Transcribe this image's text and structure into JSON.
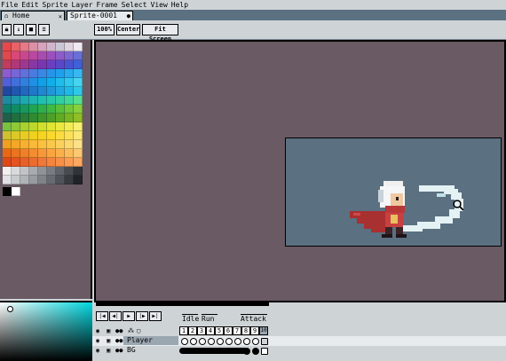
{
  "menu": [
    "File",
    "Edit",
    "Sprite",
    "Layer",
    "Frame",
    "Select",
    "View",
    "Help"
  ],
  "tabs": {
    "home": "Home",
    "sprite": "Sprite-0001",
    "close_glyph": "×",
    "add_glyph": "●"
  },
  "toolbar": {
    "zoom": "100%",
    "center": "Center",
    "fit": "Fit Screen"
  },
  "palette_icons": [
    "lock-icon",
    "sort-icon",
    "save-icon",
    "menu-icon"
  ],
  "palette_colors": [
    [
      "#e8484b",
      "#e86268",
      "#e47a88",
      "#dc90a6",
      "#d6a4bc",
      "#d0b6cc",
      "#cac6d6",
      "#e0d4e0",
      "#f0e8f0"
    ],
    [
      "#e04850",
      "#d84878",
      "#c84890",
      "#b848a0",
      "#a84cb0",
      "#9a50be",
      "#8c5cc8",
      "#7c68d0",
      "#6870d8"
    ],
    [
      "#c03c60",
      "#b03878",
      "#9c3890",
      "#8838a4",
      "#7838b0",
      "#6a40c0",
      "#5a48c8",
      "#4a54d0",
      "#4060d8"
    ],
    [
      "#8c5cd0",
      "#7866d8",
      "#6070dc",
      "#4a7ce0",
      "#3888e4",
      "#2894e8",
      "#20a0ec",
      "#28acee",
      "#38b8f0"
    ],
    [
      "#5060d8",
      "#4070dc",
      "#3080e0",
      "#2090e4",
      "#10a0e8",
      "#10aeea",
      "#20bcec",
      "#30c8ec",
      "#48d4ee"
    ],
    [
      "#2048a0",
      "#2058b0",
      "#2068c0",
      "#2078c8",
      "#2088d0",
      "#2098d8",
      "#20a8e0",
      "#20b8e4",
      "#30c8e8"
    ],
    [
      "#1e8aa0",
      "#1e98a8",
      "#1ea8b0",
      "#1eb4b0",
      "#20c0b0",
      "#28c8a8",
      "#30d0a0",
      "#40d898",
      "#58e090"
    ],
    [
      "#10806c",
      "#108c64",
      "#18985c",
      "#20a454",
      "#30ae4c",
      "#40b844",
      "#58c03c",
      "#70c83c",
      "#88d03c"
    ],
    [
      "#206048",
      "#206e40",
      "#287c38",
      "#308a30",
      "#3c962c",
      "#4ca028",
      "#60aa24",
      "#78b424",
      "#90be24"
    ],
    [
      "#7cc040",
      "#90c838",
      "#a8d030",
      "#bcd82c",
      "#d0e02c",
      "#e0e434",
      "#ece840",
      "#f4ec54",
      "#f8f070"
    ],
    [
      "#d0c030",
      "#dcc828",
      "#e8cc24",
      "#f0d020",
      "#f8d420",
      "#fcd82c",
      "#fcdc40",
      "#fce058",
      "#fce874"
    ],
    [
      "#f0a020",
      "#f4a828",
      "#f8b030",
      "#fcb838",
      "#fcc040",
      "#fcc84c",
      "#fcd05c",
      "#fcd870",
      "#fce088"
    ],
    [
      "#e86818",
      "#ec7420",
      "#f08028",
      "#f48c30",
      "#f89838",
      "#fca440",
      "#fcb04c",
      "#fcbc5c",
      "#fcc870"
    ],
    [
      "#e04818",
      "#e45420",
      "#e86028",
      "#ec6c30",
      "#f07838",
      "#f48440",
      "#f89048",
      "#fc9c54",
      "#fca860"
    ],
    [
      "#f0f0f0",
      "#d8dadc",
      "#c0c4c8",
      "#a8acb0",
      "#90949a",
      "#787c82",
      "#60646a",
      "#484c52",
      "#303438"
    ],
    [
      "#e0e2e4",
      "#c8cacc",
      "#b0b4b8",
      "#989ca0",
      "#80848a",
      "#686c72",
      "#50545a",
      "#383c42",
      "#202428"
    ],
    [
      "#000000",
      "#ffffff"
    ]
  ],
  "canvas": {
    "bg": "#6a5a63",
    "sprite_bg": "#5b7080"
  },
  "timeline": {
    "buttons": [
      "|◀",
      "◀|",
      "▶",
      "|▶",
      "▶|"
    ],
    "tags": [
      "Idle",
      "Run",
      "Attack"
    ],
    "frame_numbers": [
      "1",
      "2",
      "3",
      "4",
      "5",
      "6",
      "7",
      "8",
      "9",
      "10"
    ],
    "layers": [
      {
        "name": "Player"
      },
      {
        "name": "BG"
      }
    ],
    "header_icons": [
      "eye-icon",
      "lock-icon",
      "link-icon",
      "continuous-icon",
      "cel-icon"
    ]
  }
}
